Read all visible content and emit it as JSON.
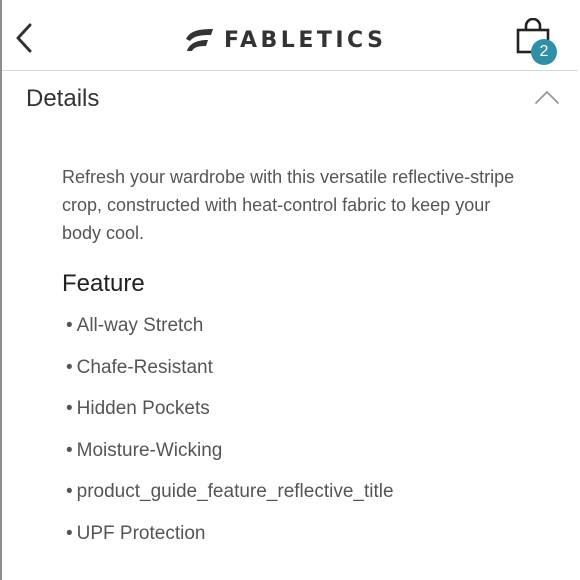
{
  "header": {
    "brand_name": "FABLETICS",
    "back_icon": "chevron-left-icon",
    "bag_icon": "shopping-bag-icon",
    "bag_count": "2",
    "badge_color": "#2f8fa6"
  },
  "section": {
    "title": "Details",
    "toggle_icon": "chevron-up-icon",
    "expanded": true
  },
  "product": {
    "description": "Refresh your wardrobe with this versatile reflective-stripe crop, constructed with heat-control fabric to keep your body cool.",
    "feature_heading": "Feature",
    "features": [
      "All-way Stretch",
      "Chafe-Resistant",
      "Hidden Pockets",
      "Moisture-Wicking",
      "product_guide_feature_reflective_title",
      "UPF Protection"
    ]
  }
}
